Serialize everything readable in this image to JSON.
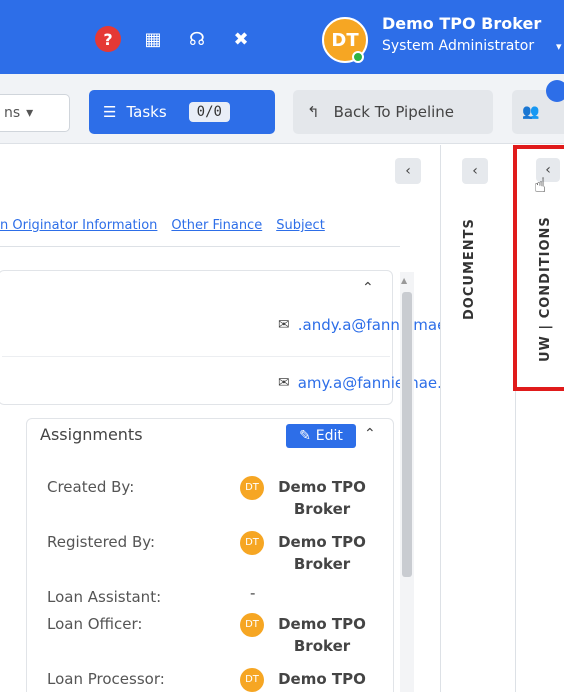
{
  "header": {
    "help_icon": "?",
    "calendar_icon": "▦",
    "support_icon": "☊",
    "expand_icon": "✖",
    "avatar_initials": "DT",
    "user_name": "Demo TPO Broker",
    "user_role": "System Administrator",
    "role_caret": "▾",
    "colors": {
      "header_bg": "#2d6ee8",
      "avatar_bg": "#f6a623",
      "help_bg": "#e53935",
      "status_dot": "#2fb344"
    }
  },
  "toolbar": {
    "actions_label": "ns",
    "actions_caret": "▾",
    "tasks_icon": "☰",
    "tasks_label": "Tasks",
    "tasks_count": "0/0",
    "back_icon": "↰",
    "back_label": "Back To Pipeline",
    "team_icon": "👥"
  },
  "main": {
    "collapse_icon": "‹",
    "nav_links": [
      "n Originator Information",
      "Other Finance",
      "Subject"
    ],
    "contact_card": {
      "caret": "⌃",
      "emails": [
        ".andy.a@fanniemae.com",
        "amy.a@fanniemae.com"
      ],
      "email_icon": "✉"
    },
    "assignments": {
      "title": "Assignments",
      "edit_label": "Edit",
      "edit_icon": "✎",
      "caret": "⌃",
      "rows": [
        {
          "label": "Created By:",
          "initials": "DT",
          "value": "Demo TPO Broker"
        },
        {
          "label": "Registered By:",
          "initials": "DT",
          "value": "Demo TPO Broker"
        },
        {
          "label": "Loan Assistant:",
          "value": "-"
        },
        {
          "label": "Loan Officer:",
          "initials": "DT",
          "value": "Demo TPO Broker"
        },
        {
          "label": "Loan Processor:",
          "initials": "DT",
          "value": "Demo TPO"
        }
      ]
    }
  },
  "side_panels": {
    "documents": {
      "collapse_icon": "‹",
      "label": "DOCUMENTS"
    },
    "uw_conditions": {
      "collapse_icon": "‹",
      "label": "UW | CONDITIONS",
      "highlight_color": "#e01b1b",
      "cursor_icon": "☝"
    }
  }
}
